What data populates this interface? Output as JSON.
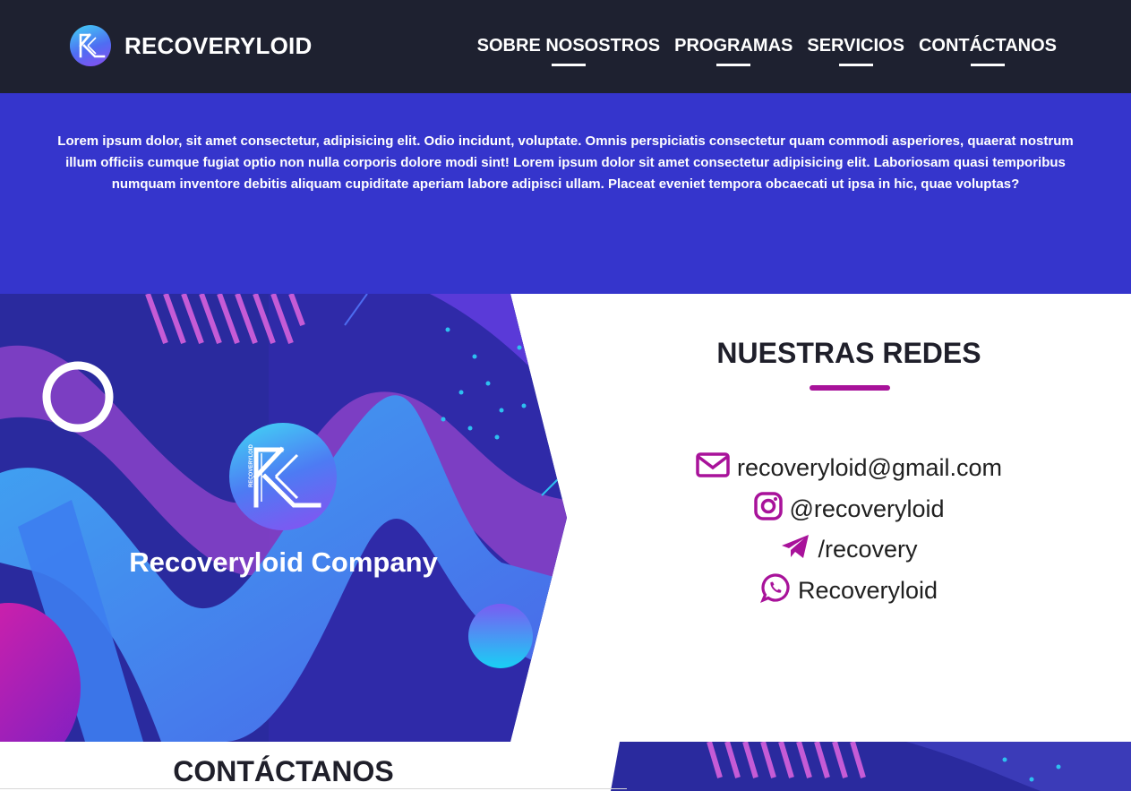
{
  "brand": {
    "name": "RECOVERYLOID"
  },
  "nav": {
    "items": [
      "SOBRE NOSOSTROS",
      "PROGRAMAS",
      "SERVICIOS",
      "CONTÁCTANOS"
    ]
  },
  "hero": {
    "text": "Lorem ipsum dolor, sit amet consectetur, adipisicing elit. Odio incidunt, voluptate. Omnis perspiciatis consectetur quam commodi asperiores, quaerat nostrum illum officiis cumque fugiat optio non nulla corporis dolore modi sint! Lorem ipsum dolor sit amet consectetur adipisicing elit. Laboriosam quasi temporibus numquam inventore debitis aliquam cupiditate aperiam labore adipisci ullam. Placeat eveniet tempora obcaecati ut ipsa in hic, quae voluptas?"
  },
  "company": {
    "name": "Recoveryloid Company",
    "logo_text": "RECOVERYLOID"
  },
  "redes": {
    "title": "NUESTRAS REDES",
    "contacts": [
      {
        "icon": "envelope-icon",
        "text": "recoveryloid@gmail.com"
      },
      {
        "icon": "instagram-icon",
        "text": "@recoveryloid"
      },
      {
        "icon": "telegram-icon",
        "text": "/recovery"
      },
      {
        "icon": "whatsapp-icon",
        "text": "Recoveryloid"
      }
    ]
  },
  "contact_section": {
    "title": "CONTÁCTANOS"
  },
  "colors": {
    "navbar": "#1e2130",
    "hero": "#3535cc",
    "accent": "#a8129a",
    "text_dark": "#1f1f2a"
  }
}
